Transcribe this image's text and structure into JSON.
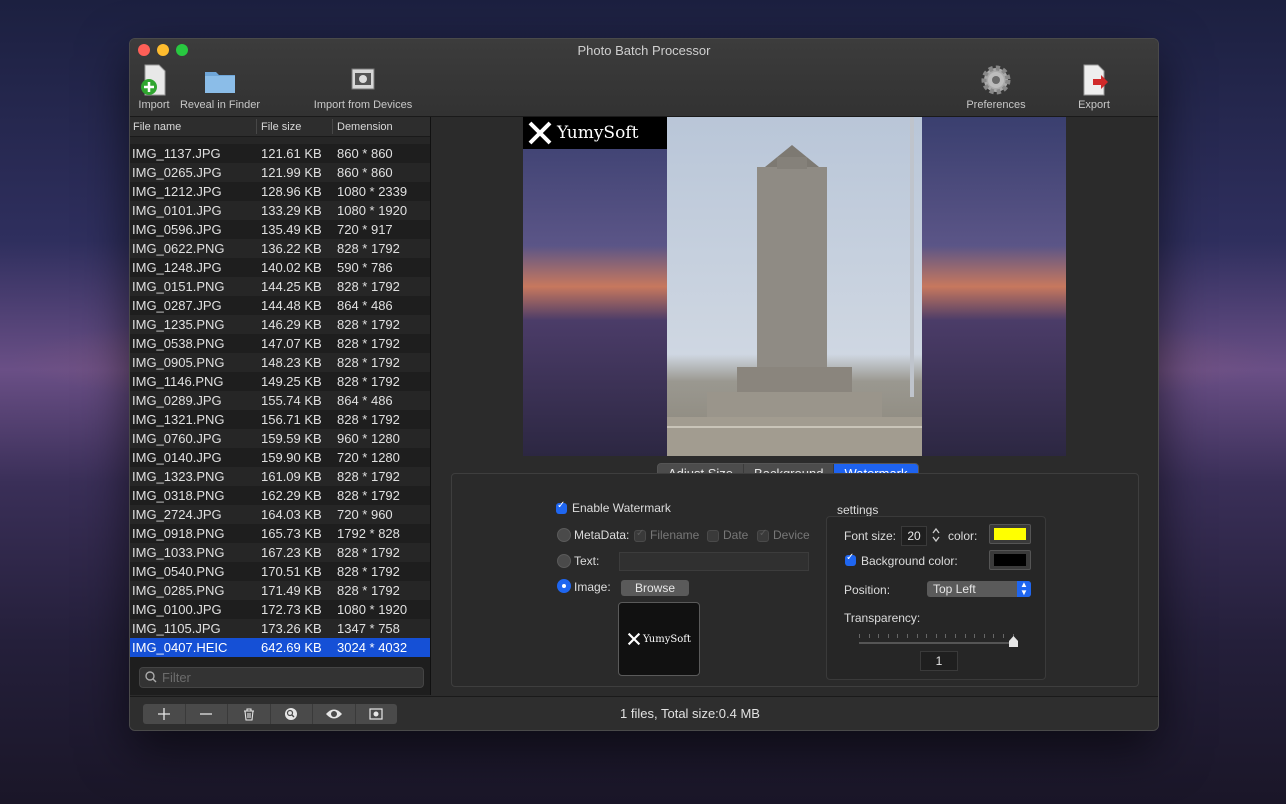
{
  "window": {
    "title": "Photo Batch Processor"
  },
  "toolbar": {
    "import": "Import",
    "reveal": "Reveal in Finder",
    "import_devices": "Import from Devices",
    "preferences": "Preferences",
    "export": "Export"
  },
  "filelist": {
    "headers": {
      "name": "File name",
      "size": "File size",
      "dimension": "Demension"
    },
    "rows": [
      {
        "name": "IMG_1137.JPG",
        "size": "121.61 KB",
        "dim": "860 * 860"
      },
      {
        "name": "IMG_0265.JPG",
        "size": "121.99 KB",
        "dim": "860 * 860"
      },
      {
        "name": "IMG_1212.JPG",
        "size": "128.96 KB",
        "dim": "1080 * 2339"
      },
      {
        "name": "IMG_0101.JPG",
        "size": "133.29 KB",
        "dim": "1080 * 1920"
      },
      {
        "name": "IMG_0596.JPG",
        "size": "135.49 KB",
        "dim": "720 * 917"
      },
      {
        "name": "IMG_0622.PNG",
        "size": "136.22 KB",
        "dim": "828 * 1792"
      },
      {
        "name": "IMG_1248.JPG",
        "size": "140.02 KB",
        "dim": "590 * 786"
      },
      {
        "name": "IMG_0151.PNG",
        "size": "144.25 KB",
        "dim": "828 * 1792"
      },
      {
        "name": "IMG_0287.JPG",
        "size": "144.48 KB",
        "dim": "864 * 486"
      },
      {
        "name": "IMG_1235.PNG",
        "size": "146.29 KB",
        "dim": "828 * 1792"
      },
      {
        "name": "IMG_0538.PNG",
        "size": "147.07 KB",
        "dim": "828 * 1792"
      },
      {
        "name": "IMG_0905.PNG",
        "size": "148.23 KB",
        "dim": "828 * 1792"
      },
      {
        "name": "IMG_1146.PNG",
        "size": "149.25 KB",
        "dim": "828 * 1792"
      },
      {
        "name": "IMG_0289.JPG",
        "size": "155.74 KB",
        "dim": "864 * 486"
      },
      {
        "name": "IMG_1321.PNG",
        "size": "156.71 KB",
        "dim": "828 * 1792"
      },
      {
        "name": "IMG_0760.JPG",
        "size": "159.59 KB",
        "dim": "960 * 1280"
      },
      {
        "name": "IMG_0140.JPG",
        "size": "159.90 KB",
        "dim": "720 * 1280"
      },
      {
        "name": "IMG_1323.PNG",
        "size": "161.09 KB",
        "dim": "828 * 1792"
      },
      {
        "name": "IMG_0318.PNG",
        "size": "162.29 KB",
        "dim": "828 * 1792"
      },
      {
        "name": "IMG_2724.JPG",
        "size": "164.03 KB",
        "dim": "720 * 960"
      },
      {
        "name": "IMG_0918.PNG",
        "size": "165.73 KB",
        "dim": "1792 * 828"
      },
      {
        "name": "IMG_1033.PNG",
        "size": "167.23 KB",
        "dim": "828 * 1792"
      },
      {
        "name": "IMG_0540.PNG",
        "size": "170.51 KB",
        "dim": "828 * 1792"
      },
      {
        "name": "IMG_0285.PNG",
        "size": "171.49 KB",
        "dim": "828 * 1792"
      },
      {
        "name": "IMG_0100.JPG",
        "size": "172.73 KB",
        "dim": "1080 * 1920"
      },
      {
        "name": "IMG_1105.JPG",
        "size": "173.26 KB",
        "dim": "1347 * 758"
      },
      {
        "name": "IMG_0407.HEIC",
        "size": "642.69 KB",
        "dim": "3024 * 4032",
        "selected": true
      }
    ],
    "filter_placeholder": "Filter"
  },
  "preview": {
    "watermark_text": "YumySoft"
  },
  "tabs": [
    "Adjust Size",
    "Background",
    "Watermark"
  ],
  "active_tab": "Watermark",
  "watermark": {
    "enable_label": "Enable Watermark",
    "metadata_label": "MetaData:",
    "meta_filename": "Filename",
    "meta_date": "Date",
    "meta_device": "Device",
    "text_label": "Text:",
    "image_label": "Image:",
    "browse": "Browse",
    "thumb_text": "YumySoft"
  },
  "settings": {
    "title": "settings",
    "font_size_label": "Font size:",
    "font_size_value": "20",
    "color_label": "color:",
    "color_value": "#ffff00",
    "bg_color_label": "Background color:",
    "bg_color_value": "#000000",
    "position_label": "Position:",
    "position_value": "Top Left",
    "transparency_label": "Transparency:",
    "transparency_value": "1"
  },
  "status": "1 files, Total size:0.4 MB",
  "bottom_buttons": [
    "add-icon",
    "minus-icon",
    "trash-icon",
    "zoom-icon",
    "eye-icon",
    "camera-icon"
  ]
}
